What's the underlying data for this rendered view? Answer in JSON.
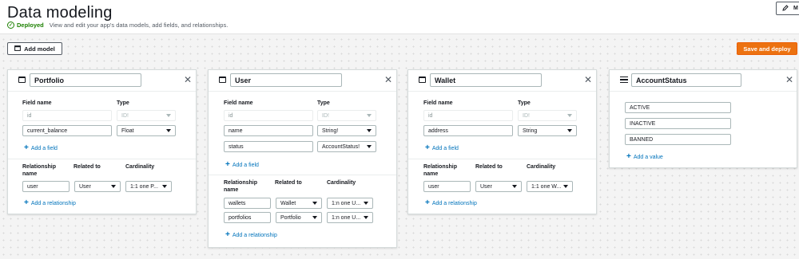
{
  "header": {
    "title": "Data modeling",
    "status": "Deployed",
    "description": "View and edit your app's data models, add fields, and relationships.",
    "corner_button_label": "M"
  },
  "toolbar": {
    "add_model_label": "Add model",
    "deploy_label": "Save and deploy"
  },
  "labels": {
    "field_name": "Field name",
    "type": "Type",
    "relationship": "Relationship",
    "relationship_name": "name",
    "related_to": "Related to",
    "cardinality": "Cardinality",
    "add_field": "Add a field",
    "add_relationship": "Add a relationship",
    "add_value": "Add a value"
  },
  "models": [
    {
      "name": "Portfolio",
      "fields": [
        {
          "name": "id",
          "type": "ID!"
        },
        {
          "name": "current_balance",
          "type": "Float"
        }
      ],
      "relationships": [
        {
          "name": "user",
          "related_to": "User",
          "cardinality": "1:1 one P..."
        }
      ]
    },
    {
      "name": "User",
      "fields": [
        {
          "name": "id",
          "type": "ID!"
        },
        {
          "name": "name",
          "type": "String!"
        },
        {
          "name": "status",
          "type": "AccountStatus!"
        }
      ],
      "relationships": [
        {
          "name": "wallets",
          "related_to": "Wallet",
          "cardinality": "1:n one U..."
        },
        {
          "name": "portfolios",
          "related_to": "Portfolio",
          "cardinality": "1:n one U..."
        }
      ]
    },
    {
      "name": "Wallet",
      "fields": [
        {
          "name": "id",
          "type": "ID!"
        },
        {
          "name": "address",
          "type": "String"
        }
      ],
      "relationships": [
        {
          "name": "user",
          "related_to": "User",
          "cardinality": "1:1 one W..."
        }
      ]
    }
  ],
  "enum": {
    "name": "AccountStatus",
    "values": [
      "ACTIVE",
      "INACTIVE",
      "BANNED"
    ]
  },
  "colors": {
    "accent": "#ec7211",
    "link": "#0073bb",
    "success": "#1d8102"
  }
}
